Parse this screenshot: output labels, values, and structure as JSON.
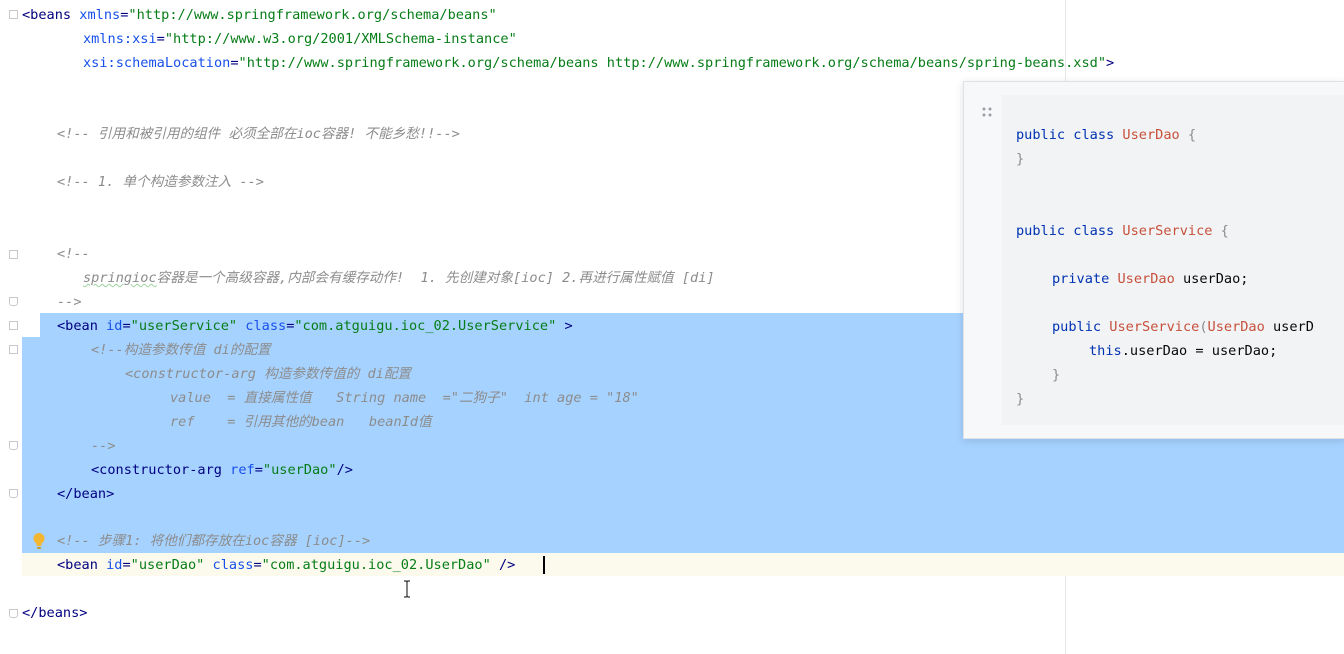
{
  "editor": {
    "lines": {
      "l1": {
        "open": "<beans ",
        "attr": "xmlns",
        "eq": "=",
        "val": "\"http://www.springframework.org/schema/beans\""
      },
      "l2": {
        "attr": "xmlns:xsi",
        "eq": "=",
        "val": "\"http://www.w3.org/2001/XMLSchema-instance\""
      },
      "l3": {
        "attr": "xsi:schemaLocation",
        "eq": "=",
        "val": "\"http://www.springframework.org/schema/beans http://www.springframework.org/schema/beans/spring-beans.xsd\"",
        "close": ">"
      },
      "l4": "<!-- 引用和被引用的组件 必须全部在ioc容器! 不能乡愁!!-->",
      "l5": "<!-- 1. 单个构造参数注入 -->",
      "l6": "<!--",
      "l7a": "springioc",
      "l7b": "容器是一个高级容器,内部会有缓存动作!  1. 先创建对象[ioc] 2.再进行属性赋值 [di]",
      "l8": "-->",
      "l9": {
        "open": "<bean ",
        "attr1": "id",
        "val1": "\"userService\"",
        "attr2": "class",
        "val2": "\"com.atguigu.ioc_02.UserService\"",
        "close": " >"
      },
      "l10": "<!--构造参数传值 di的配置",
      "l11": "<constructor-arg 构造参数传值的 di配置",
      "l12": "value  = 直接属性值   String name  =\"二狗子\"  int age = \"18\"",
      "l13": "ref    = 引用其他的bean   beanId值",
      "l14": "-->",
      "l15": {
        "open": "<constructor-arg ",
        "attr": "ref",
        "val": "\"userDao\"",
        "close": "/>"
      },
      "l16": "</bean>",
      "l17": "<!-- 步骤1: 将他们都存放在ioc容器 [ioc]-->",
      "l18": {
        "open": "<bean ",
        "attr1": "id",
        "val1": "\"userDao\"",
        "attr2": "class",
        "val2": "\"com.atguigu.ioc_02.UserDao\"",
        "close": " />"
      },
      "l19": "</beans>"
    }
  },
  "popup": {
    "p1": {
      "kw": "public class ",
      "cls": "UserDao",
      "rest": " {"
    },
    "p2": "}",
    "p3": {
      "kw": "public class ",
      "cls": "UserService",
      "rest": " {"
    },
    "p4": {
      "kw": "private ",
      "cls": "UserDao",
      "rest": " userDao;"
    },
    "p5": {
      "kw": "public ",
      "cls": "UserService",
      "paren": "(",
      "cls2": "UserDao",
      "rest": " userD"
    },
    "p6": {
      "kw": "this",
      "rest": ".userDao = userDao;"
    },
    "p7": "}",
    "p8": "}"
  }
}
